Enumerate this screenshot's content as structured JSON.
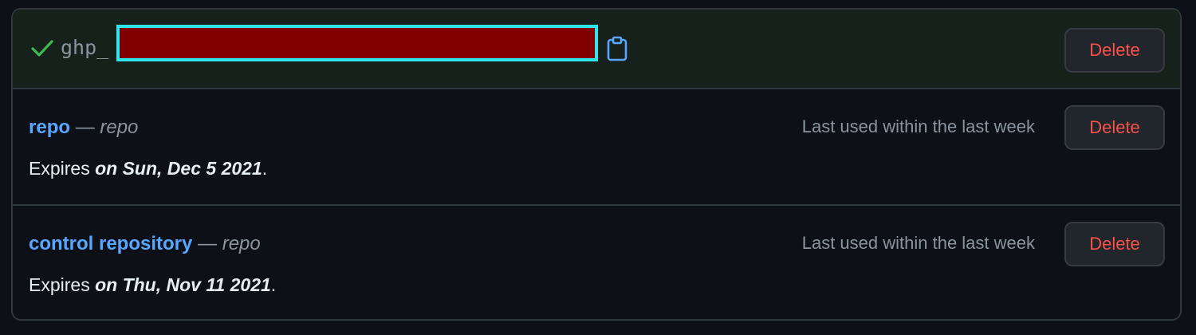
{
  "new_token": {
    "prefix": "ghp_",
    "value": "",
    "delete_label": "Delete",
    "icons": {
      "status": "check-icon",
      "copy": "clipboard-icon"
    },
    "colors": {
      "check": "#3fb950",
      "redaction_fill": "#800000",
      "redaction_border": "#2ee6ee"
    }
  },
  "tokens": [
    {
      "name": "repo",
      "separator": "—",
      "scopes": "repo",
      "last_used": "Last used within the last week",
      "expires_prefix": "Expires",
      "expires_date": "on Sun, Dec 5 2021",
      "expires_suffix": ".",
      "delete_label": "Delete"
    },
    {
      "name": "control repository",
      "separator": "—",
      "scopes": "repo",
      "last_used": "Last used within the last week",
      "expires_prefix": "Expires",
      "expires_date": "on Thu, Nov 11 2021",
      "expires_suffix": ".",
      "delete_label": "Delete"
    }
  ],
  "colors": {
    "background": "#0d1117",
    "link": "#58a6ff",
    "danger": "#f85149",
    "muted": "#8b949e",
    "success_row": "#15211a"
  }
}
